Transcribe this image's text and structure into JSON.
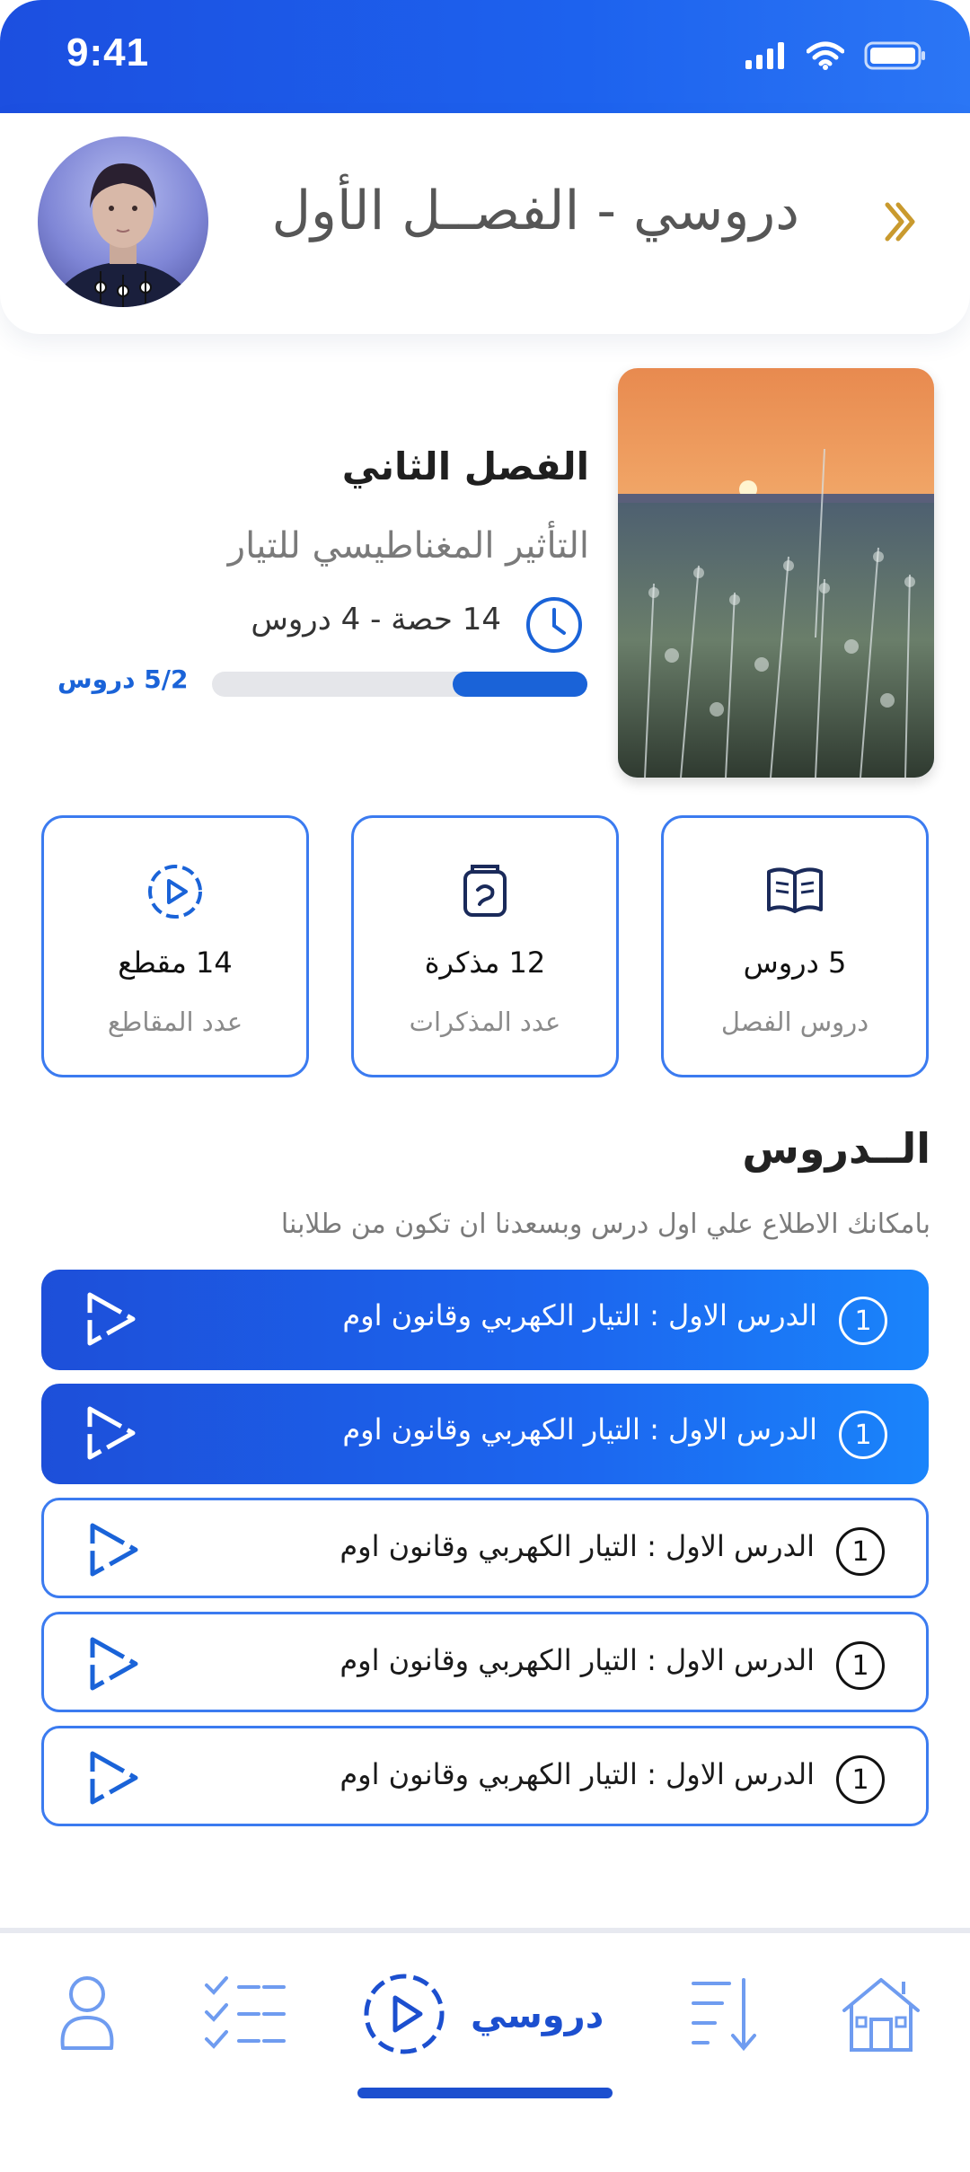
{
  "status_bar": {
    "time": "9:41"
  },
  "header": {
    "title": "دروسي - الفصــل الأول"
  },
  "chapter": {
    "title": "الفصل الثاني",
    "subtitle": "التأثير المغناطيسي للتيار",
    "meta": "14 حصة - 4 دروس",
    "progress_fraction": 0.36,
    "progress_label": "5/2 دروس"
  },
  "stats": [
    {
      "icon": "book-icon",
      "value": "5 دروس",
      "label": "دروس الفصل"
    },
    {
      "icon": "notes-icon",
      "value": "12 مذكرة",
      "label": "عدد المذكرات"
    },
    {
      "icon": "play-circle-icon",
      "value": "14 مقطع",
      "label": "عدد المقاطع"
    }
  ],
  "lessons_section": {
    "title": "الــدروس",
    "description": "بامكانك الاطلاع علي اول درس وبسعدنا ان تكون من طلابنا"
  },
  "lessons": [
    {
      "number": "1",
      "title": "الدرس الاول : التيار الكهربي وقانون اوم",
      "active": true
    },
    {
      "number": "1",
      "title": "الدرس الاول : التيار الكهربي وقانون اوم",
      "active": true
    },
    {
      "number": "1",
      "title": "الدرس الاول : التيار الكهربي وقانون اوم",
      "active": false
    },
    {
      "number": "1",
      "title": "الدرس الاول : التيار الكهربي وقانون اوم",
      "active": false
    },
    {
      "number": "1",
      "title": "الدرس الاول : التيار الكهربي وقانون اوم",
      "active": false
    }
  ],
  "bottom_nav": {
    "items": [
      "profile-icon",
      "checklist-icon",
      "play-circle-icon",
      "sort-icon",
      "home-icon"
    ],
    "active_label": "دروسي"
  },
  "colors": {
    "primary": "#1c4fe0",
    "accent": "#3b7bf0",
    "chevron": "#c99a2e"
  }
}
